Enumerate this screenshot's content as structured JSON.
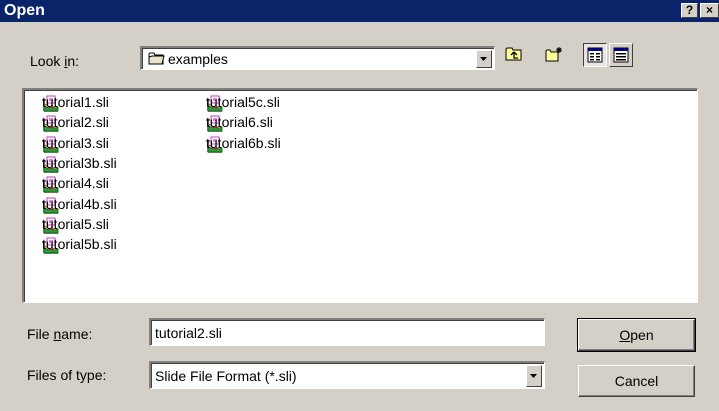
{
  "window": {
    "title": "Open",
    "help_glyph": "?",
    "close_glyph": "×"
  },
  "look_in": {
    "label_pre": "Look ",
    "label_key": "i",
    "label_post": "n:",
    "value": "examples"
  },
  "files": [
    {
      "name": "tutorial1.sli"
    },
    {
      "name": "tutorial2.sli"
    },
    {
      "name": "tutorial3.sli"
    },
    {
      "name": "tutorial3b.sli"
    },
    {
      "name": "tutorial4.sli"
    },
    {
      "name": "tutorial4b.sli"
    },
    {
      "name": "tutorial5.sli"
    },
    {
      "name": "tutorial5b.sli"
    },
    {
      "name": "tutorial5c.sli"
    },
    {
      "name": "tutorial6.sli"
    },
    {
      "name": "tutorial6b.sli"
    }
  ],
  "file_name": {
    "label_pre": "File ",
    "label_key": "n",
    "label_post": "ame:",
    "value": "tutorial2.sli"
  },
  "file_type": {
    "label": "Files of type:",
    "value": "Slide File Format (*.sli)"
  },
  "buttons": {
    "open_key": "O",
    "open_rest": "pen",
    "cancel": "Cancel"
  },
  "icons": {
    "folder": "folder-icon",
    "up": "up-folder-icon",
    "new_folder": "new-folder-icon",
    "list": "list-view-icon",
    "details": "details-view-icon",
    "file": "slide-file-icon"
  }
}
